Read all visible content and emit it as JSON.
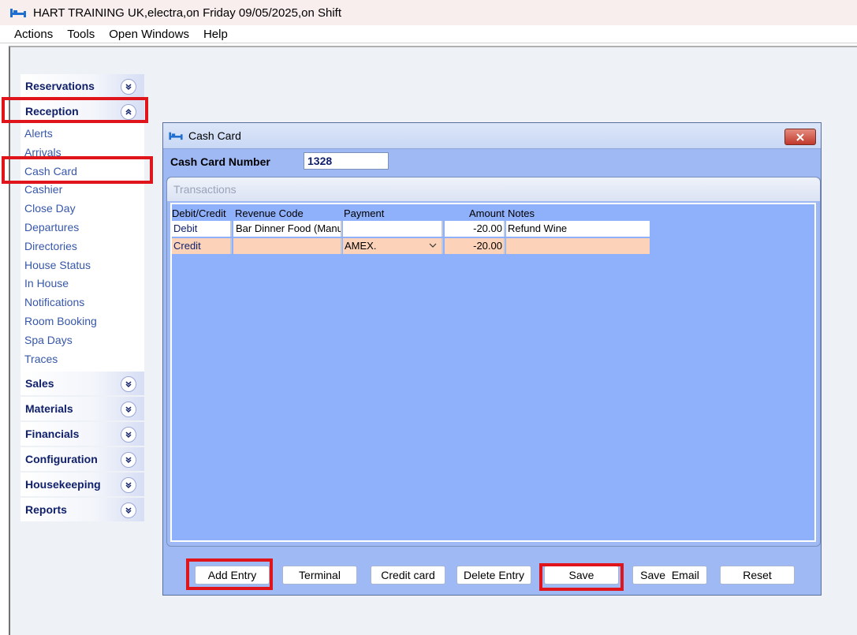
{
  "app": {
    "title": "HART TRAINING UK,electra,on Friday 09/05/2025,on Shift",
    "icon": "bed-icon"
  },
  "menu": {
    "items": [
      "Actions",
      "Tools",
      "Open Windows",
      "Help"
    ]
  },
  "sidebar": {
    "sections_top": [
      {
        "label": "Reservations",
        "state": "collapsed"
      },
      {
        "label": "Reception",
        "state": "expanded"
      }
    ],
    "reception_items": [
      "Alerts",
      "Arrivals",
      "Cash Card",
      "Cashier",
      "Close Day",
      "Departures",
      "Directories",
      "House Status",
      "In House",
      "Notifications",
      "Room Booking",
      "Spa Days",
      "Traces"
    ],
    "sections_bottom": [
      {
        "label": "Sales",
        "state": "collapsed"
      },
      {
        "label": "Materials",
        "state": "collapsed"
      },
      {
        "label": "Financials",
        "state": "collapsed"
      },
      {
        "label": "Configuration",
        "state": "collapsed"
      },
      {
        "label": "Housekeeping",
        "state": "collapsed"
      },
      {
        "label": "Reports",
        "state": "collapsed"
      }
    ]
  },
  "window": {
    "title": "Cash Card",
    "card_number_label": "Cash Card Number",
    "card_number_value": "1328",
    "transactions_label": "Transactions",
    "columns": [
      "Debit/Credit",
      "Revenue Code",
      "Payment",
      "Amount",
      "Notes"
    ],
    "rows": [
      {
        "type": "Debit",
        "revenue_code": "Bar Dinner Food (Manu",
        "payment": "",
        "amount": "-20.00",
        "notes": "Refund Wine"
      },
      {
        "type": "Credit",
        "revenue_code": "",
        "payment": "AMEX.",
        "amount": "-20.00",
        "notes": ""
      }
    ],
    "buttons": [
      "Add Entry",
      "Terminal",
      "Credit card",
      "Delete Entry",
      "Save",
      "Save  Email",
      "Reset"
    ]
  },
  "colors": {
    "highlight": "#e0141b",
    "window_bg": "#9fb9f5",
    "credit_row": "#fcd3b8",
    "nav_link": "#3657a8",
    "section_header": "#10206b"
  }
}
